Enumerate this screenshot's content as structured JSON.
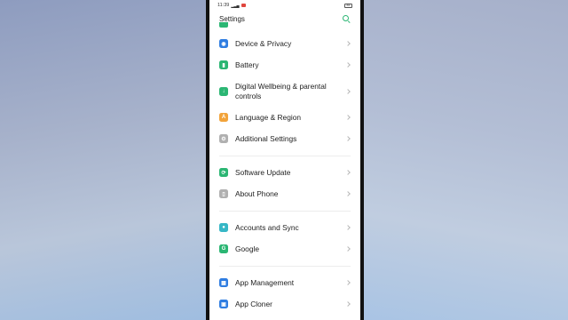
{
  "status_bar": {
    "time": "11:39",
    "battery": "85"
  },
  "app_bar": {
    "title": "Settings",
    "search_icon": "search-icon"
  },
  "items": [
    {
      "label": "Device & Privacy",
      "icon": "shield-icon",
      "color": "#2f7de1"
    },
    {
      "label": "Battery",
      "icon": "battery-icon",
      "color": "#2bb673"
    },
    {
      "label": "Digital Wellbeing & parental controls",
      "icon": "wellbeing-icon",
      "color": "#2bb673"
    },
    {
      "label": "Language & Region",
      "icon": "globe-icon",
      "color": "#f2a33a"
    },
    {
      "label": "Additional Settings",
      "icon": "gear-icon",
      "color": "#b0b0b0"
    },
    {
      "label": "Software Update",
      "icon": "update-icon",
      "color": "#2bb673"
    },
    {
      "label": "About Phone",
      "icon": "info-icon",
      "color": "#b0b0b0"
    },
    {
      "label": "Accounts and Sync",
      "icon": "user-icon",
      "color": "#36b7c6"
    },
    {
      "label": "Google",
      "icon": "google-icon",
      "color": "#2bb673"
    },
    {
      "label": "App Management",
      "icon": "apps-icon",
      "color": "#2f7de1"
    },
    {
      "label": "App Cloner",
      "icon": "clone-icon",
      "color": "#2f7de1"
    }
  ]
}
